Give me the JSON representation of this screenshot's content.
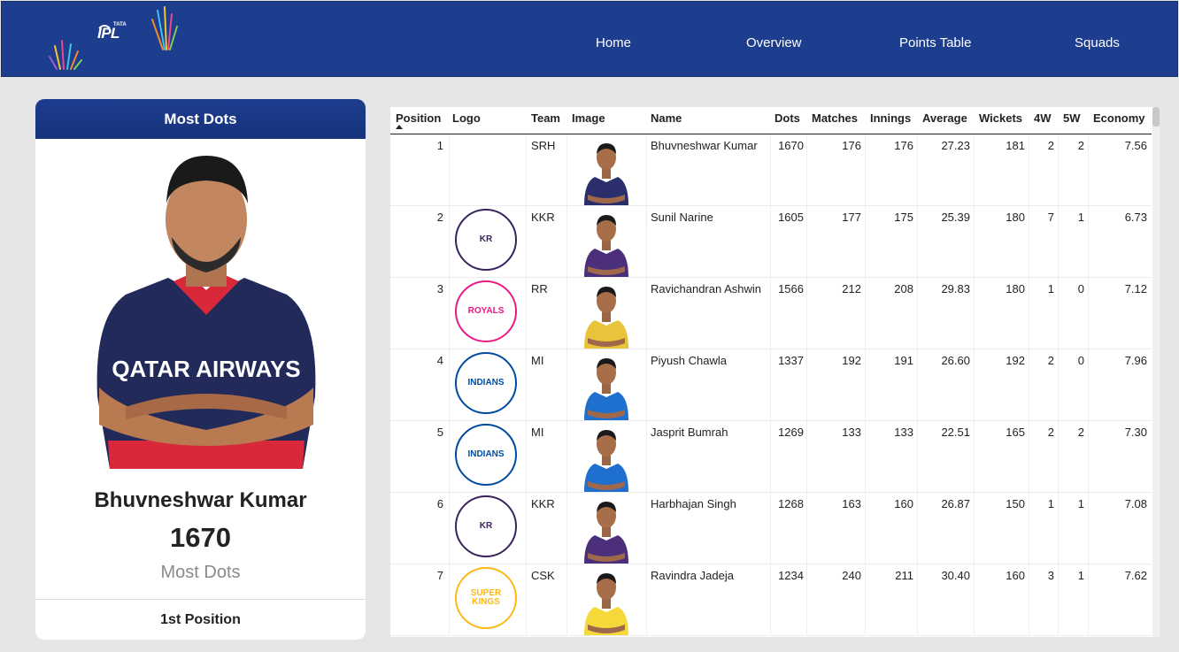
{
  "nav": {
    "logo": {
      "text": "IPL",
      "sub": "TATA"
    },
    "links": [
      "Home",
      "Overview",
      "Points Table",
      "Squads"
    ]
  },
  "card": {
    "title": "Most Dots",
    "player_name": "Bhuvneshwar Kumar",
    "value": "1670",
    "metric": "Most Dots",
    "position": "1st Position",
    "jersey_sponsor": "QATAR AIRWAYS"
  },
  "table": {
    "columns": [
      "Position",
      "Logo",
      "Team",
      "Image",
      "Name",
      "Dots",
      "Matches",
      "Innings",
      "Average",
      "Wickets",
      "4W",
      "5W",
      "Economy"
    ],
    "rows": [
      {
        "pos": "1",
        "team": "SRH",
        "name": "Bhuvneshwar Kumar",
        "dots": "1670",
        "matches": "176",
        "innings": "176",
        "average": "27.23",
        "wickets": "181",
        "w4": "2",
        "w5": "2",
        "economy": "7.56",
        "logo": ""
      },
      {
        "pos": "2",
        "team": "KKR",
        "name": "Sunil Narine",
        "dots": "1605",
        "matches": "177",
        "innings": "175",
        "average": "25.39",
        "wickets": "180",
        "w4": "7",
        "w5": "1",
        "economy": "6.73",
        "logo": "KR"
      },
      {
        "pos": "3",
        "team": "RR",
        "name": "Ravichandran Ashwin",
        "dots": "1566",
        "matches": "212",
        "innings": "208",
        "average": "29.83",
        "wickets": "180",
        "w4": "1",
        "w5": "0",
        "economy": "7.12",
        "logo": "ROYALS"
      },
      {
        "pos": "4",
        "team": "MI",
        "name": "Piyush Chawla",
        "dots": "1337",
        "matches": "192",
        "innings": "191",
        "average": "26.60",
        "wickets": "192",
        "w4": "2",
        "w5": "0",
        "economy": "7.96",
        "logo": "INDIANS"
      },
      {
        "pos": "5",
        "team": "MI",
        "name": "Jasprit Bumrah",
        "dots": "1269",
        "matches": "133",
        "innings": "133",
        "average": "22.51",
        "wickets": "165",
        "w4": "2",
        "w5": "2",
        "economy": "7.30",
        "logo": "INDIANS"
      },
      {
        "pos": "6",
        "team": "KKR",
        "name": "Harbhajan Singh",
        "dots": "1268",
        "matches": "163",
        "innings": "160",
        "average": "26.87",
        "wickets": "150",
        "w4": "1",
        "w5": "1",
        "economy": "7.08",
        "logo": "KR"
      },
      {
        "pos": "7",
        "team": "CSK",
        "name": "Ravindra Jadeja",
        "dots": "1234",
        "matches": "240",
        "innings": "211",
        "average": "30.40",
        "wickets": "160",
        "w4": "3",
        "w5": "1",
        "economy": "7.62",
        "logo": "SUPER KINGS"
      }
    ]
  },
  "colors": {
    "nav_bg": "#1d3d8f",
    "page_bg": "#e6e6e6",
    "team": {
      "SRH": "#ff822a",
      "KKR": "#3a225d",
      "RR": "#ea1a85",
      "MI": "#004ba0",
      "CSK": "#fdb913"
    },
    "jersey": {
      "SRH": "#2a2f6b",
      "KKR": "#4b2f7a",
      "RR": "#e8c43a",
      "MI": "#1f6fcf",
      "CSK": "#f5d93a"
    }
  }
}
